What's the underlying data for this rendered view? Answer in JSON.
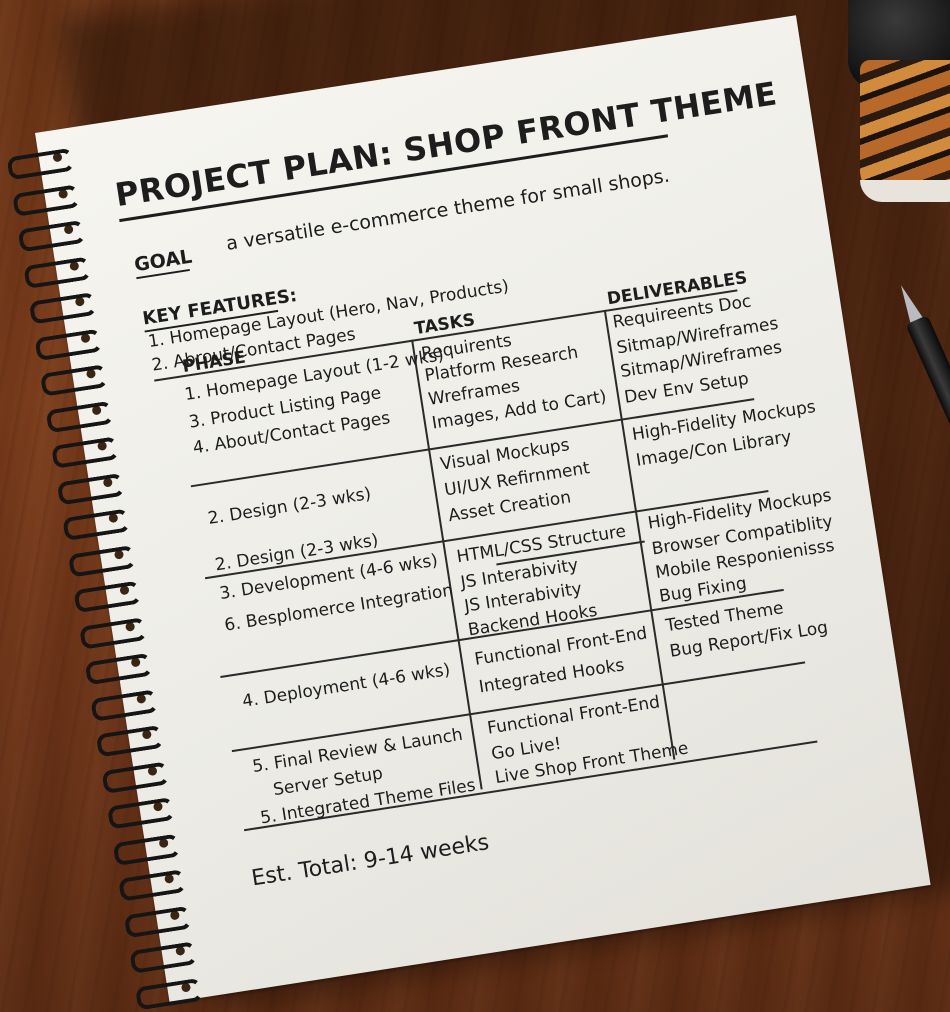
{
  "notebook": {
    "title": "PROJECT PLAN: SHOP FRONT THEME",
    "goal_label": "GOAL",
    "goal_text": "a versatile e-commerce theme for small shops.",
    "key_features_label": "KEY FEATURES:",
    "key_features": [
      "1.  Homepage Layout (Hero, Nav, Products)",
      "2.  Abrout/Contact Pages"
    ],
    "table": {
      "headers": {
        "phase": "PHASE",
        "tasks": "TASKS",
        "deliverables": "DELIVERABLES"
      },
      "phase_lines": [
        "1.  Homepage Layout (1-2 wks)",
        "3.  Product Listing Page",
        "4.  About/Contact Pages",
        "2.  Design (2-3 wks)",
        "2.  Design (2-3 wks)",
        "3.  Development (4-6 wks)",
        "6.  Besplomerce Integration",
        "4.  Deployment (4-6 wks)",
        "5.  Final Review & Launch",
        "Server Setup",
        "5.  Integrated Theme Files"
      ],
      "task_lines": [
        "Requirents",
        "Platform Research",
        "Wreframes",
        "Images, Add to Cart)",
        "Visual Mockups",
        "UI/UX Refirnment",
        "Asset Creation",
        "HTML/CSS Structure",
        "JS Interabivity",
        "JS Interabivity",
        "Backend Hooks",
        "Functional Front-End",
        "Integrated Hooks",
        "Functional Front-End",
        "Go Live!",
        "Live Shop Front Theme"
      ],
      "deliverable_lines": [
        "Requireents Doc",
        "Sitmap/Wireframes",
        "Sitmap/Wireframes",
        "Dev Env Setup",
        "High-Fidelity Mockups",
        "Image/Con Library",
        "High-Fidelity Mockups",
        "Browser Compatiblity",
        "Mobile Responienisss",
        "Bug Fixing",
        "Tested Theme",
        "Bug Report/Fix Log"
      ]
    },
    "estimate": "Est. Total: 9-14 weeks"
  },
  "colors": {
    "ink": "#1d1d1d",
    "paper": "#f2f1eb",
    "desk": "#6e3618"
  },
  "icons": [
    "coffee-cup-icon",
    "pen-icon",
    "spiral-binding-icon"
  ]
}
